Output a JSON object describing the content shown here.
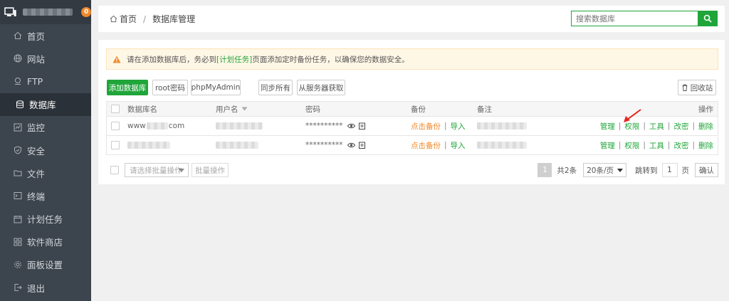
{
  "sidebar": {
    "badge": "0",
    "items": [
      {
        "label": "首页",
        "icon": "home-icon"
      },
      {
        "label": "网站",
        "icon": "globe-icon"
      },
      {
        "label": "FTP",
        "icon": "ftp-icon"
      },
      {
        "label": "数据库",
        "icon": "database-icon"
      },
      {
        "label": "监控",
        "icon": "monitor-icon"
      },
      {
        "label": "安全",
        "icon": "shield-icon"
      },
      {
        "label": "文件",
        "icon": "folder-icon"
      },
      {
        "label": "终端",
        "icon": "terminal-icon"
      },
      {
        "label": "计划任务",
        "icon": "calendar-icon"
      },
      {
        "label": "软件商店",
        "icon": "grid-icon"
      },
      {
        "label": "面板设置",
        "icon": "gear-icon"
      },
      {
        "label": "退出",
        "icon": "logout-icon"
      }
    ]
  },
  "header": {
    "crumb_home": "首页",
    "crumb_sep": "/",
    "crumb_current": "数据库管理",
    "search_placeholder": "搜索数据库"
  },
  "alert": {
    "text_before": "请在添加数据库后，务必到",
    "link": "[计划任务]",
    "text_after": "页面添加定时备份任务，以确保您的数据安全。"
  },
  "toolbar": {
    "add_db": "添加数据库",
    "root_pwd": "root密码",
    "phpmyadmin": "phpMyAdmin",
    "sync_all": "同步所有",
    "sync_server": "从服务器获取",
    "recycle": "回收站"
  },
  "table": {
    "headers": {
      "name": "数据库名",
      "user": "用户名",
      "password": "密码",
      "backup": "备份",
      "note": "备注",
      "ops": "操作"
    },
    "rows": [
      {
        "name_prefix": "www",
        "name_suffix": "com",
        "password": "**********",
        "backup": "点击备份",
        "import": "导入"
      },
      {
        "name_prefix": "",
        "name_suffix": "",
        "password": "**********",
        "backup": "点击备份",
        "import": "导入"
      }
    ],
    "actions": [
      "管理",
      "权限",
      "工具",
      "改密",
      "删除"
    ],
    "action_sep": "|",
    "backup_sep": "|"
  },
  "footer": {
    "batch_placeholder": "请选择批量操作",
    "batch_btn": "批量操作",
    "page_current": "1",
    "total": "共2条",
    "per_page": "20条/页",
    "goto_label": "跳转到",
    "goto_value": "1",
    "page_unit": "页",
    "confirm": "确认"
  },
  "colors": {
    "brand_green": "#20a53a",
    "accent_orange": "#f0892a",
    "annotation_red": "#e8251f"
  }
}
